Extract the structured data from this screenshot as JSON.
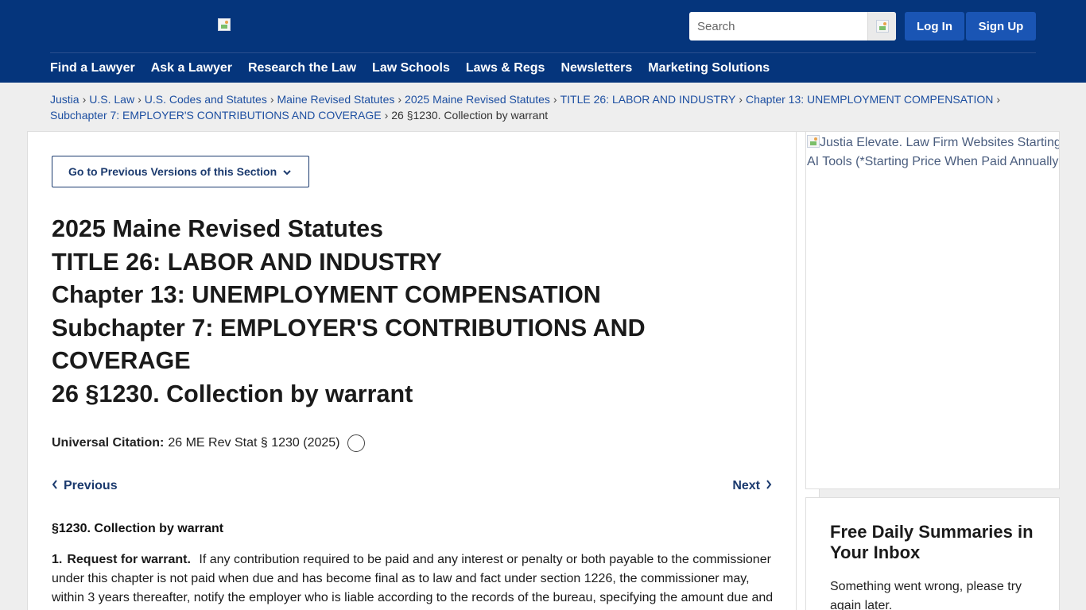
{
  "header": {
    "search_placeholder": "Search",
    "login_label": "Log In",
    "signup_label": "Sign Up",
    "nav": [
      "Find a Lawyer",
      "Ask a Lawyer",
      "Research the Law",
      "Law Schools",
      "Laws & Regs",
      "Newsletters",
      "Marketing Solutions"
    ]
  },
  "breadcrumb": {
    "links": [
      "Justia",
      "U.S. Law",
      "U.S. Codes and Statutes",
      "Maine Revised Statutes",
      "2025 Maine Revised Statutes",
      "TITLE 26: LABOR AND INDUSTRY",
      "Chapter 13: UNEMPLOYMENT COMPENSATION",
      "Subchapter 7: EMPLOYER'S CONTRIBUTIONS AND COVERAGE"
    ],
    "current": "26 §1230. Collection by warrant",
    "separator": "›"
  },
  "main": {
    "prev_versions_label": "Go to Previous Versions of this Section",
    "title_lines": [
      "2025 Maine Revised Statutes",
      "TITLE 26: LABOR AND INDUSTRY",
      "Chapter 13: UNEMPLOYMENT COMPENSATION",
      "Subchapter 7: EMPLOYER'S CONTRIBUTIONS AND COVERAGE",
      "26 §1230. Collection by warrant"
    ],
    "citation_label": "Universal Citation:",
    "citation_value": "26 ME Rev Stat § 1230 (2025)",
    "previous_label": "Previous",
    "next_label": "Next",
    "section_heading": "§1230. Collection by warrant",
    "para_number": "1.",
    "para_title": "Request for warrant.",
    "para_text": "If any contribution required to be paid and any interest or penalty or both payable to the commissioner under this chapter is not paid when due and has become final as to law and fact under section 1226, the commissioner may, within 3 years thereafter, notify the employer who is liable according to the records of the bureau, specifying the amount due and"
  },
  "sidebar": {
    "ad_alt": "Justia Elevate. Law Firm Websites Starting at $... AI Tools (*Starting Price When Paid Annually)",
    "ad_line1": "Justia Elevate. Law Firm Websites Starting",
    "ad_line2": "AI Tools (*Starting Price When Paid Annually",
    "newsletter_title": "Free Daily Summaries in Your Inbox",
    "newsletter_error": "Something went wrong, please try again later."
  },
  "colors": {
    "header_bg": "#05357c",
    "button_bg": "#1a55b4",
    "link": "#1d4fa1"
  }
}
